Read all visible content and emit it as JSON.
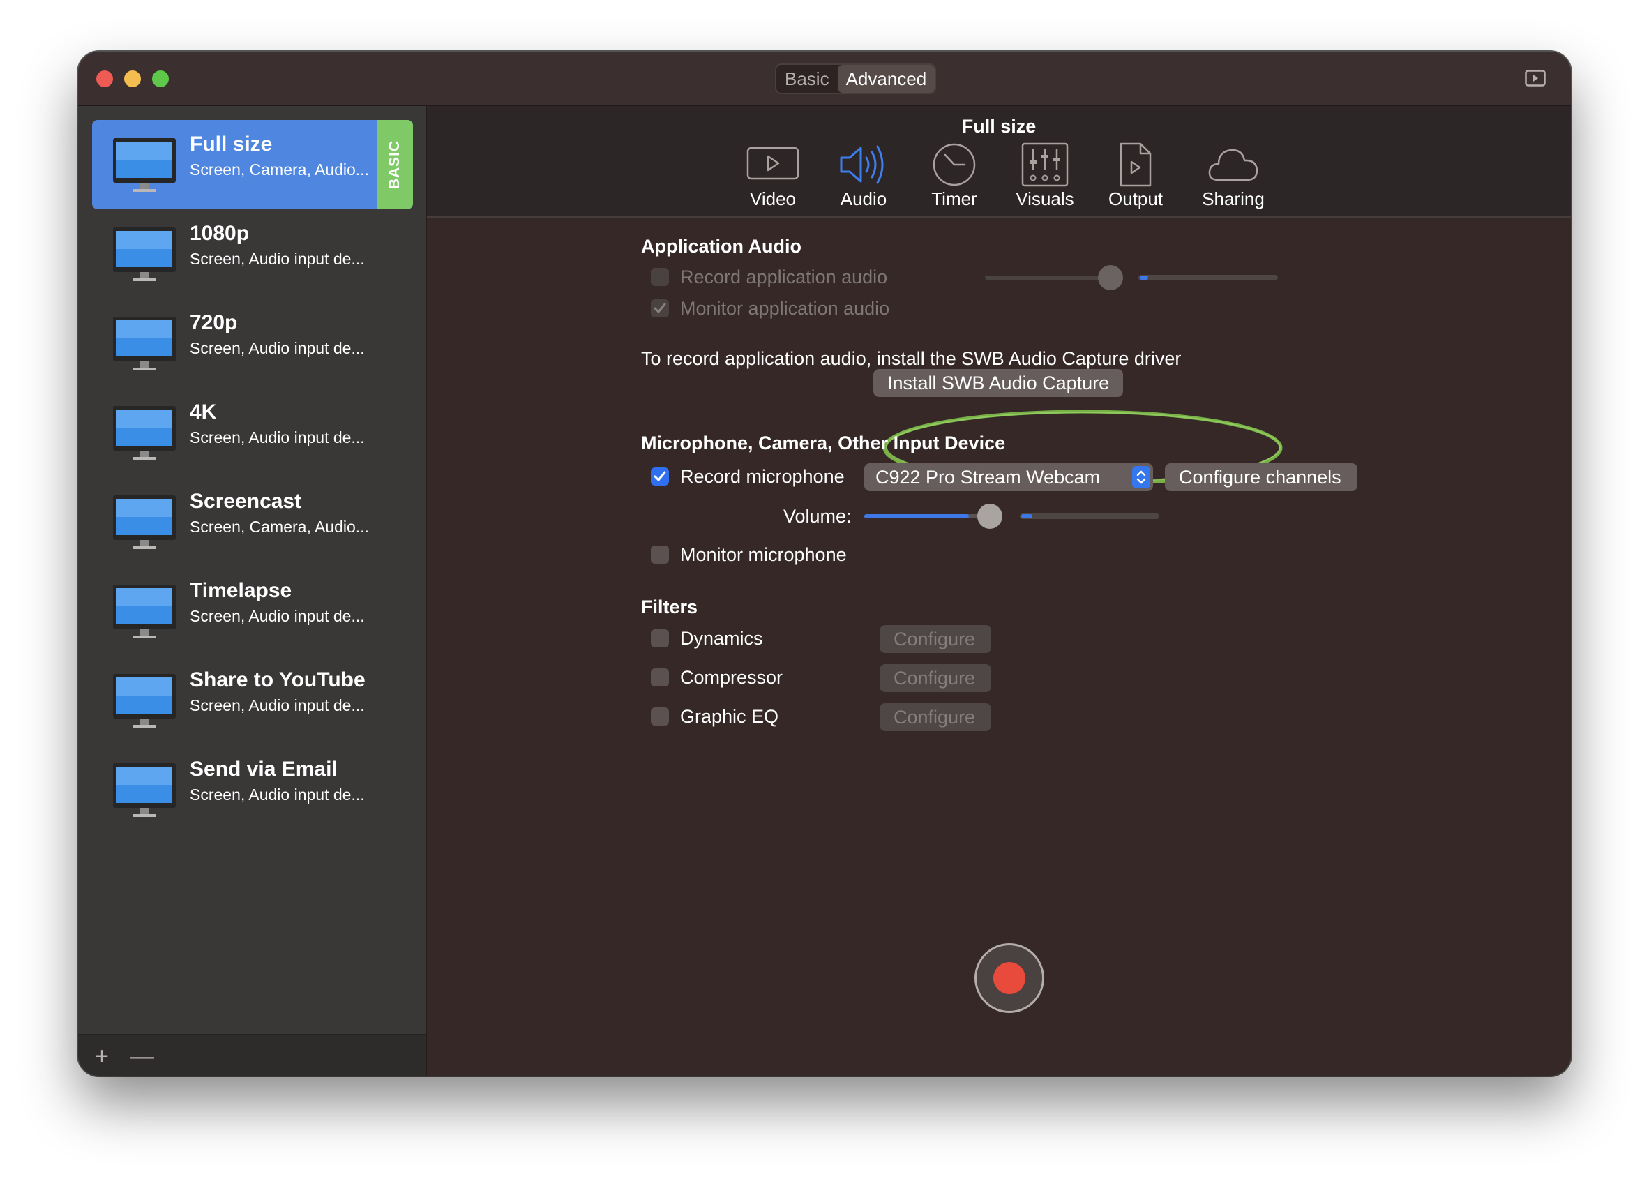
{
  "titlebar": {
    "segments": [
      {
        "label": "Basic",
        "active": false
      },
      {
        "label": "Advanced",
        "active": true
      }
    ],
    "right_icon": "play-in-window-icon"
  },
  "sidebar": {
    "presets": [
      {
        "name": "Full size",
        "desc": "Screen, Camera, Audio...",
        "selected": true,
        "tag": "BASIC"
      },
      {
        "name": "1080p",
        "desc": "Screen, Audio input de...",
        "selected": false
      },
      {
        "name": "720p",
        "desc": "Screen, Audio input de...",
        "selected": false
      },
      {
        "name": "4K",
        "desc": "Screen, Audio input de...",
        "selected": false
      },
      {
        "name": "Screencast",
        "desc": "Screen, Camera, Audio...",
        "selected": false
      },
      {
        "name": "Timelapse",
        "desc": "Screen, Audio input de...",
        "selected": false
      },
      {
        "name": "Share to YouTube",
        "desc": "Screen, Audio input de...",
        "selected": false
      },
      {
        "name": "Send via Email",
        "desc": "Screen, Audio input de...",
        "selected": false
      }
    ],
    "footer": {
      "add": "+",
      "remove": "—"
    }
  },
  "main": {
    "title": "Full size",
    "tools": [
      {
        "label": "Video",
        "icon": "video-icon",
        "active": false
      },
      {
        "label": "Audio",
        "icon": "speaker-icon",
        "active": true
      },
      {
        "label": "Timer",
        "icon": "clock-icon",
        "active": false
      },
      {
        "label": "Visuals",
        "icon": "sliders-icon",
        "active": false
      },
      {
        "label": "Output",
        "icon": "document-play-icon",
        "active": false
      },
      {
        "label": "Sharing",
        "icon": "cloud-icon",
        "active": false
      }
    ],
    "app_audio": {
      "heading": "Application Audio",
      "record_label": "Record application audio",
      "record_checked": false,
      "monitor_label": "Monitor application audio",
      "monitor_checked": true,
      "slider_value": 0.8,
      "note": "To record application audio, install the SWB Audio Capture driver",
      "install_button": "Install SWB Audio Capture"
    },
    "input": {
      "heading": "Microphone, Camera, Other Input Device",
      "record_mic_label": "Record microphone",
      "record_mic_checked": true,
      "device": "C922 Pro Stream Webcam",
      "configure_channels": "Configure channels",
      "volume_label": "Volume:",
      "volume_value": 0.8,
      "monitor_mic_label": "Monitor microphone",
      "monitor_mic_checked": false
    },
    "filters": {
      "heading": "Filters",
      "items": [
        {
          "label": "Dynamics",
          "checked": false,
          "button": "Configure"
        },
        {
          "label": "Compressor",
          "checked": false,
          "button": "Configure"
        },
        {
          "label": "Graphic EQ",
          "checked": false,
          "button": "Configure"
        }
      ]
    },
    "colors": {
      "accent": "#3d78e6",
      "record": "#e84a3c",
      "annotation": "#7fc04a",
      "basic_tag": "#7fca66"
    }
  }
}
